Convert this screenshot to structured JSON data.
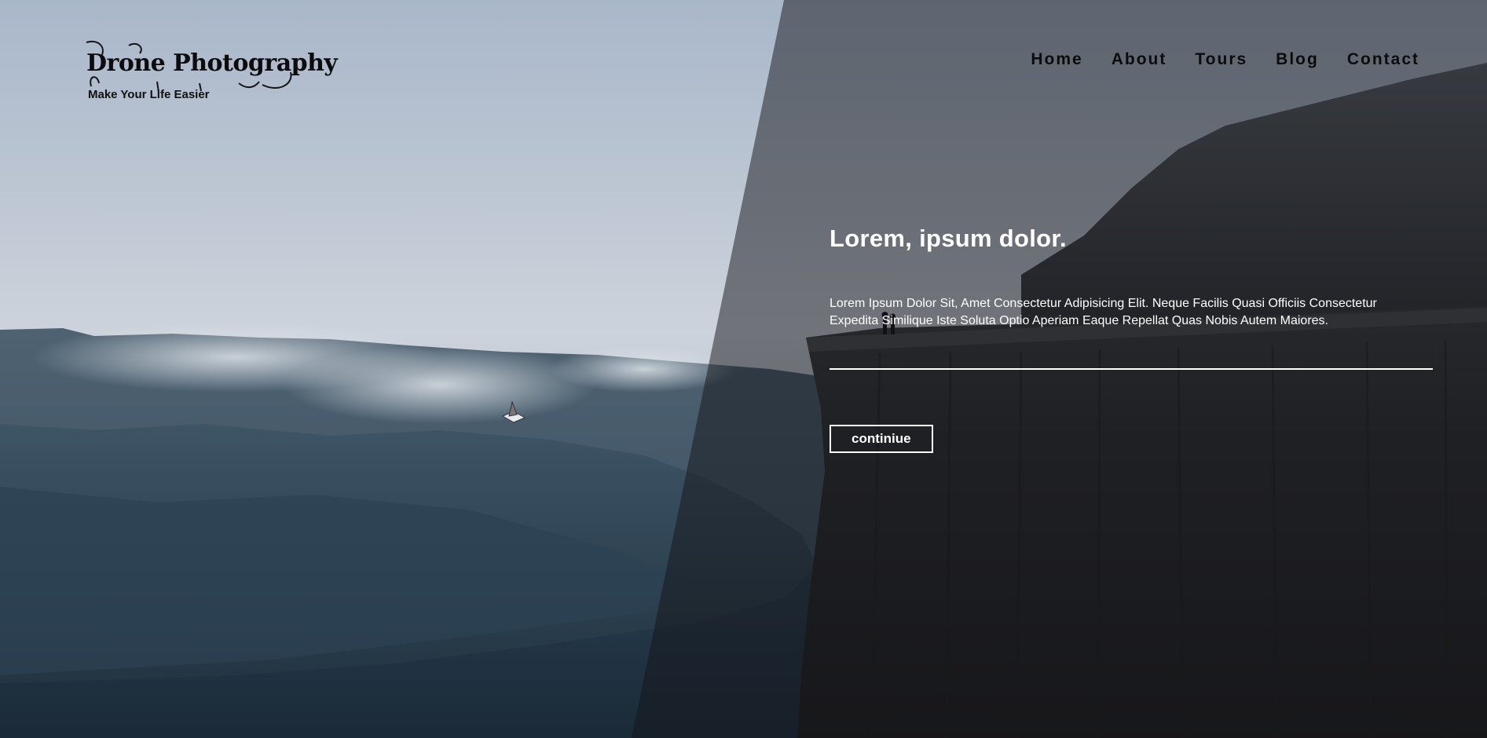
{
  "brand": {
    "logo_text": "Drone Photography",
    "tagline": "Make Your Life Easier",
    "logo_icon": "ink-flourish-icon"
  },
  "nav": {
    "items": [
      {
        "label": "Home"
      },
      {
        "label": "About"
      },
      {
        "label": "Tours"
      },
      {
        "label": "Blog"
      },
      {
        "label": "Contact"
      }
    ]
  },
  "hero": {
    "title": "Lorem, ipsum dolor.",
    "text": "Lorem Ipsum Dolor Sit, Amet Consectetur Adipisicing Elit. Neque Facilis Quasi Officiis Consectetur Expedita Similique Iste Soluta Optio Aperiam Eaque Repellat Quas Nobis Autem Maiores.",
    "button_label": "continiue"
  },
  "background": {
    "description_icon": "fjord-cliff-photo",
    "sky_color": "#c2cbd7",
    "overlay_color": "#141418"
  }
}
